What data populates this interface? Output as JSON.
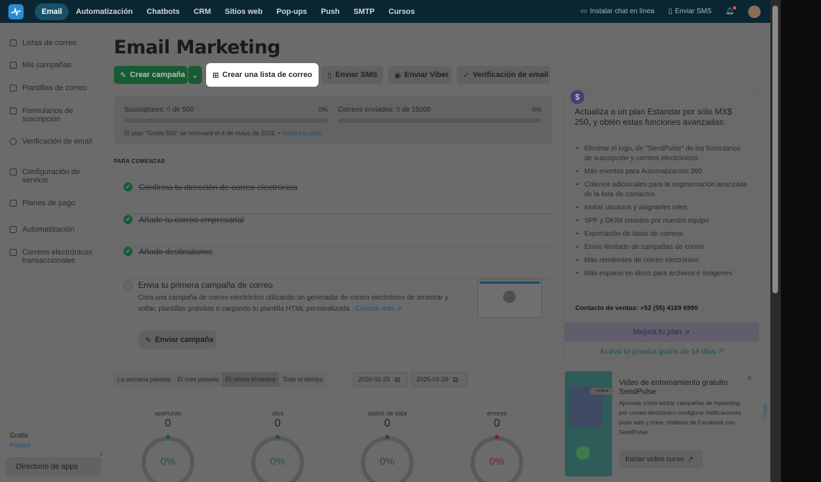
{
  "topnav": {
    "items": [
      "Email",
      "Automatización",
      "Chatbots",
      "CRM",
      "Sitios web",
      "Pop-ups",
      "Push",
      "SMTP",
      "Cursos"
    ],
    "active": "Email",
    "install_chat": "Instalar chat en línea",
    "send_sms": "Enviar SMS"
  },
  "sidebar": {
    "items": [
      "Listas de correo",
      "Mis campañas",
      "Plantillas de correo",
      "Formularios de suscripción",
      "Verificación de email",
      "Configuración de servicio",
      "Planes de pago",
      "Automatización",
      "Correos electrónicos transaccionales"
    ],
    "plan_label": "Gratis",
    "plan_link": "Precios",
    "apps": "Directorio de apps"
  },
  "main": {
    "title": "Email Marketing",
    "actions": {
      "create_campaign": "Crear campaña",
      "create_list": "Crear una lista de correo",
      "send_sms": "Enviar SMS",
      "send_viber": "Enviar Viber",
      "verify_email": "Verificación de email"
    },
    "stats": {
      "subscribers_label": "Suscriptores:",
      "subscribers_value": "0",
      "subscribers_of": "de 500",
      "subscribers_pct": "0%",
      "emails_label": "Correos enviados:",
      "emails_value": "0",
      "emails_of": "de 15000",
      "emails_pct": "0%",
      "plan_note": "El plan \"Gratis 500\" se renovará el 4 de mayo de 2026. •",
      "upgrade_link": "Mejora tu plan"
    },
    "getting_started": {
      "title": "PARA COMENZAR",
      "done_steps": [
        "Confirma tu dirección de correo electrónico",
        "Añade tu correo empresarial",
        "Añadir destinatarios"
      ],
      "next_title": "Envia tu primera campaña de correo",
      "next_desc": "Crea una campaña de correo electrónico utilizando un generador de correo electrónico de arrastrar y soltar, plantillas gratuitas o cargando tu plantilla HTML personalizada .",
      "more_link": "Conoce más",
      "send_button": "Enviar campaña"
    },
    "period": {
      "tabs": [
        "La semana pasada",
        "El mes pasado",
        "El último trimestre",
        "Todo el tiempo"
      ],
      "active": "El último trimestre",
      "date_from": "2026-01-29",
      "date_to": "2026-04-29"
    },
    "metrics": [
      {
        "label": "aperturas",
        "value": "0",
        "percent": "0%",
        "color": "#1a5a34"
      },
      {
        "label": "clics",
        "value": "0",
        "percent": "0%",
        "color": "#1a5a34"
      },
      {
        "label": "dados de baja",
        "value": "0",
        "percent": "0%",
        "color": "#3d3d3d"
      },
      {
        "label": "errores",
        "value": "0",
        "percent": "0%",
        "color": "#7a2222"
      }
    ]
  },
  "promo": {
    "icon": "$",
    "title": "Actualiza a un plan Estandar por sólo MX$ 250, y obtén estas funciones avanzadas:",
    "features": [
      "Eliminar el logo, de \"SendPulse\" de los formularios de suscripción y correos electrónicos",
      "Más eventos para Automatización 360",
      "Criterios adicionales para la segmentación avanzada de la lista de contactos",
      "Invitar usuarios y asignarles roles",
      "SPF y DKIM creados por nuestro equipo",
      "Exportación de listas de correos",
      "Envío ilimitado de campañas de correo",
      "Más remitentes de correo electrónico",
      "Más espacio en disco para archivos e imágenes"
    ],
    "contact": "Contacto de ventas: +52 (55) 4169 6990",
    "upgrade": "Mejora tu plan",
    "trial": "Activa tu prueba gratis de 14 días"
  },
  "video": {
    "title": "Video de entrenamiento gratuito SendPulse",
    "desc": "Aprende cómo lanzar campañas de marketing por correo electrónico configurar notificaciones push web y crear chatbots de Facebook con SendPulse.",
    "pill": "• online",
    "button": "Iniciar video curso"
  },
  "chats_tab": "Chats"
}
